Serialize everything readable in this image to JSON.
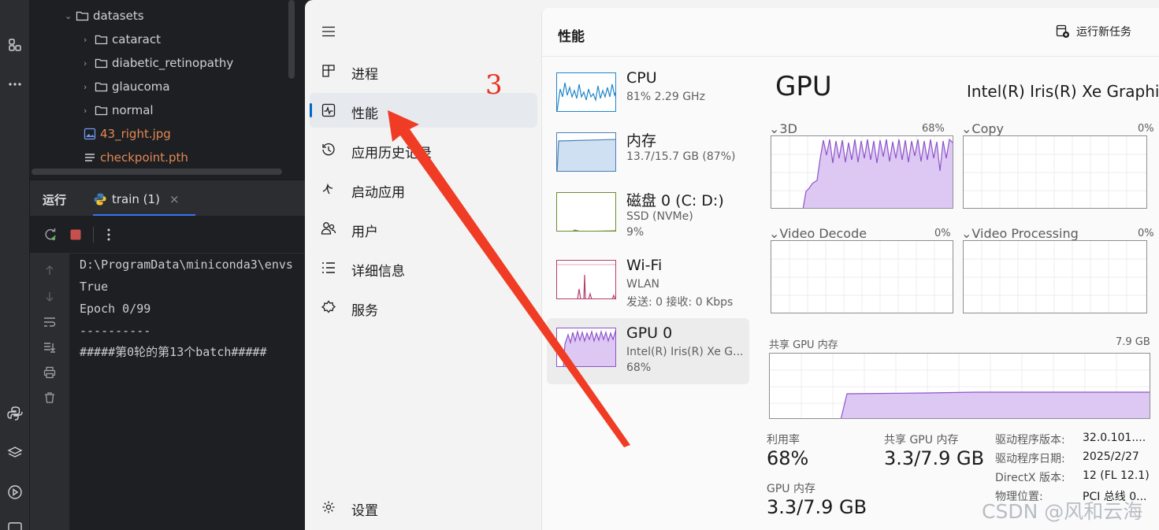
{
  "ide": {
    "tree": [
      {
        "label": "datasets",
        "type": "folder",
        "expanded": true
      },
      {
        "label": "cataract",
        "type": "folder"
      },
      {
        "label": "diabetic_retinopathy",
        "type": "folder"
      },
      {
        "label": "glaucoma",
        "type": "folder"
      },
      {
        "label": "normal",
        "type": "folder"
      },
      {
        "label": "43_right.jpg",
        "type": "image"
      },
      {
        "label": "checkpoint.pth",
        "type": "file"
      }
    ],
    "run": {
      "title": "运行",
      "tab_label": "train (1)",
      "close": "×"
    },
    "console_lines": [
      "D:\\ProgramData\\miniconda3\\envs",
      "True",
      "Epoch 0/99",
      "----------",
      "#####第0轮的第13个batch#####"
    ]
  },
  "task_manager": {
    "nav": [
      {
        "icon": "processes-icon",
        "label": "进程"
      },
      {
        "icon": "performance-icon",
        "label": "性能",
        "active": true
      },
      {
        "icon": "app-history-icon",
        "label": "应用历史记录"
      },
      {
        "icon": "startup-apps-icon",
        "label": "启动应用"
      },
      {
        "icon": "users-icon",
        "label": "用户"
      },
      {
        "icon": "details-icon",
        "label": "详细信息"
      },
      {
        "icon": "services-icon",
        "label": "服务"
      }
    ],
    "settings_label": "设置",
    "page_title": "性能",
    "new_task_label": "运行新任务",
    "resources": [
      {
        "name": "CPU",
        "line1": "81% 2.29 GHz",
        "line2": ""
      },
      {
        "name": "内存",
        "line1": "13.7/15.7 GB (87%)",
        "line2": ""
      },
      {
        "name": "磁盘 0 (C: D:)",
        "line1": "SSD (NVMe)",
        "line2": "9%"
      },
      {
        "name": "Wi-Fi",
        "line1": "WLAN",
        "line2": "发送: 0 接收: 0 Kbps"
      },
      {
        "name": "GPU 0",
        "line1": "Intel(R) Iris(R) Xe G...",
        "line2": "68%",
        "active": true
      }
    ],
    "gpu": {
      "title": "GPU",
      "model": "Intel(R) Iris(R) Xe Graphics",
      "engines": [
        {
          "label": "3D",
          "percent": "68%"
        },
        {
          "label": "Copy",
          "percent": "0%"
        },
        {
          "label": "Video Decode",
          "percent": "0%"
        },
        {
          "label": "Video Processing",
          "percent": "0%"
        }
      ],
      "shared_memory_label": "共享 GPU 内存",
      "shared_memory_max": "7.9 GB",
      "stats": {
        "utilization_label": "利用率",
        "utilization_value": "68%",
        "shared_label": "共享 GPU 内存",
        "shared_value": "3.3/7.9 GB",
        "gpu_mem_label": "GPU 内存",
        "gpu_mem_value": "3.3/7.9 GB"
      },
      "info": [
        {
          "key": "驱动程序版本:",
          "value": "32.0.101...."
        },
        {
          "key": "驱动程序日期:",
          "value": "2025/2/27"
        },
        {
          "key": "DirectX 版本:",
          "value": "12 (FL 12.1)"
        },
        {
          "key": "物理位置:",
          "value": "PCI 总线 0..."
        }
      ]
    }
  },
  "annotation": {
    "step_number": "3",
    "arrow_color": "#f03c24"
  },
  "watermark": "CSDN @风和云海"
}
